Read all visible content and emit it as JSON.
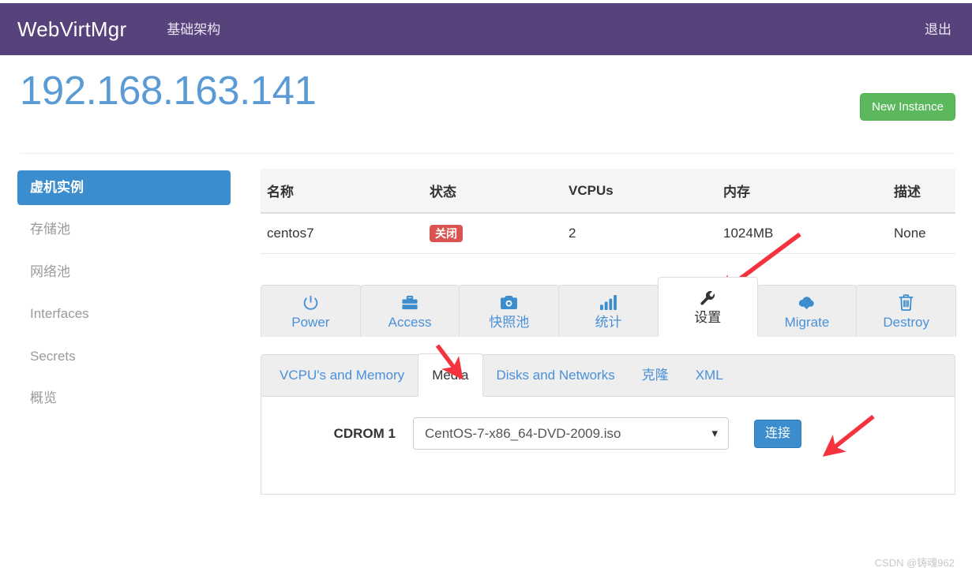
{
  "navbar": {
    "brand": "WebVirtMgr",
    "links": [
      {
        "label": "基础架构",
        "name": "nav-link-infrastructure"
      }
    ],
    "logout": "退出"
  },
  "page": {
    "title": "192.168.163.141",
    "new_instance_button": "New Instance"
  },
  "sidebar": {
    "items": [
      {
        "label": "虚机实例",
        "active": true
      },
      {
        "label": "存储池",
        "active": false
      },
      {
        "label": "网络池",
        "active": false
      },
      {
        "label": "Interfaces",
        "active": false
      },
      {
        "label": "Secrets",
        "active": false
      },
      {
        "label": "概览",
        "active": false
      }
    ]
  },
  "instances_table": {
    "columns": [
      "名称",
      "状态",
      "VCPUs",
      "内存",
      "描述"
    ],
    "rows": [
      {
        "name": "centos7",
        "state": "关闭",
        "vcpus": "2",
        "memory": "1024MB",
        "description": "None"
      }
    ]
  },
  "icon_tabs": [
    {
      "label": "Power",
      "icon": "power-icon",
      "active": false
    },
    {
      "label": "Access",
      "icon": "briefcase-icon",
      "active": false
    },
    {
      "label": "快照池",
      "icon": "camera-icon",
      "active": false
    },
    {
      "label": "统计",
      "icon": "chart-bar-icon",
      "active": false
    },
    {
      "label": "设置",
      "icon": "wrench-icon",
      "active": true
    },
    {
      "label": "Migrate",
      "icon": "cloud-download-icon",
      "active": false
    },
    {
      "label": "Destroy",
      "icon": "trash-icon",
      "active": false
    }
  ],
  "sub_tabs": [
    {
      "label": "VCPU's and Memory",
      "active": false
    },
    {
      "label": "Media",
      "active": true
    },
    {
      "label": "Disks and Networks",
      "active": false
    },
    {
      "label": "克隆",
      "active": false
    },
    {
      "label": "XML",
      "active": false
    }
  ],
  "media": {
    "cdrom_label": "CDROM 1",
    "iso_selected": "CentOS-7-x86_64-DVD-2009.iso",
    "connect_button": "连接"
  },
  "watermark": "CSDN @铸魂962",
  "colors": {
    "navbar_purple": "#58427c",
    "title_blue": "#5b9bd5",
    "primary_blue": "#3c8dcd",
    "success_green": "#5cb85c",
    "danger_red": "#d9534f",
    "annotation_red": "#f5333f",
    "link_blue": "#4a90d9"
  }
}
